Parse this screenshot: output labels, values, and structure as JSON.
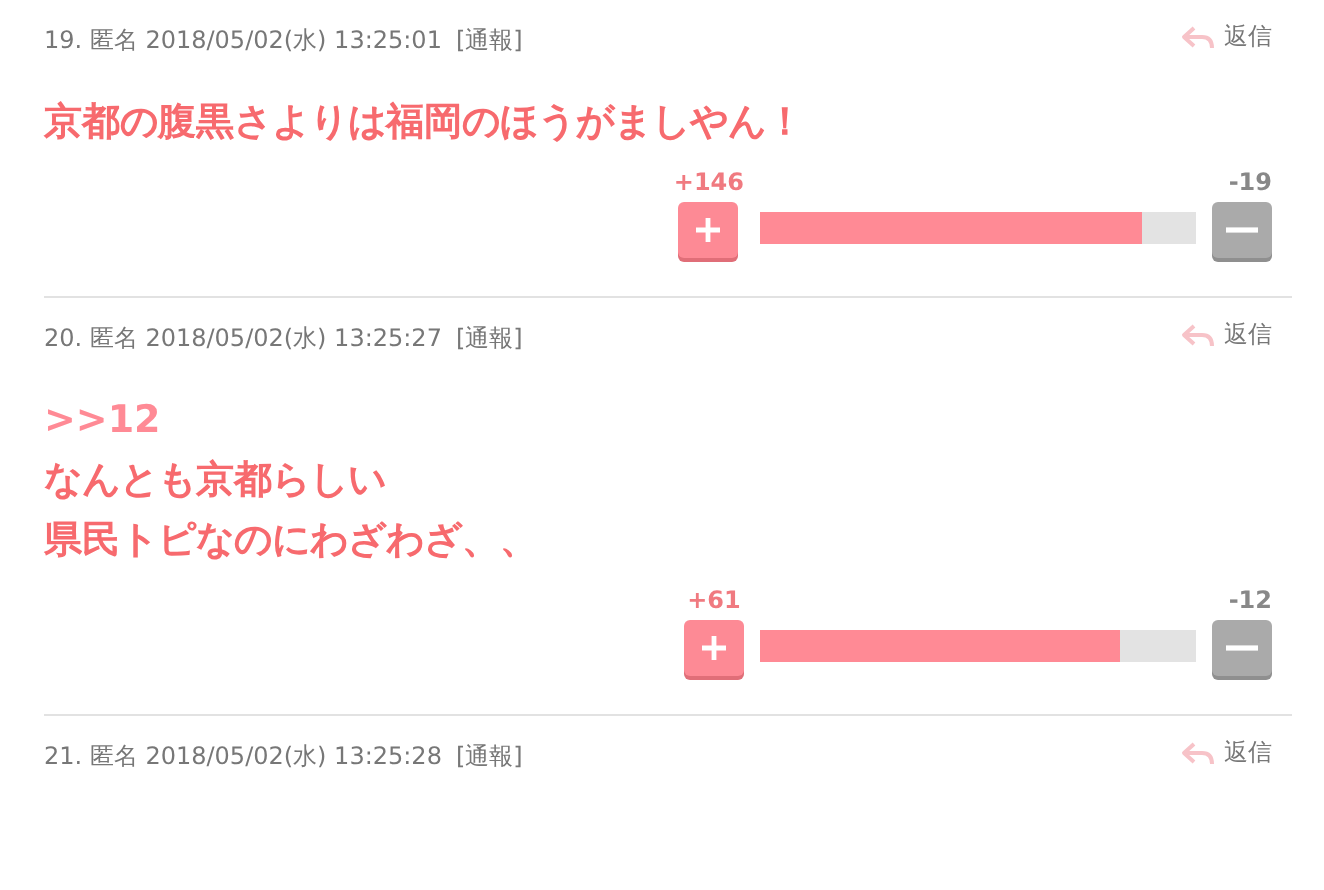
{
  "comments": [
    {
      "number": "19.",
      "author": "匿名",
      "date": "2018/05/02(水) 13:25:01",
      "report": "[通報]",
      "reply": "返信",
      "lines": [
        {
          "kind": "text",
          "text": "京都の腹黒さよりは福岡のほうがましやん！"
        }
      ],
      "vote": {
        "plus": "+146",
        "minus": "-19",
        "level": 0.876
      }
    },
    {
      "number": "20.",
      "author": "匿名",
      "date": "2018/05/02(水) 13:25:27",
      "report": "[通報]",
      "reply": "返信",
      "lines": [
        {
          "kind": "anchor",
          "text": ">>12"
        },
        {
          "kind": "text",
          "text": "なんとも京都らしい"
        },
        {
          "kind": "text",
          "text": "県民トピなのにわざわざ、、"
        }
      ],
      "vote": {
        "plus": "+61",
        "minus": "-12",
        "level": 0.826
      }
    },
    {
      "number": "21.",
      "author": "匿名",
      "date": "2018/05/02(水) 13:25:28",
      "report": "[通報]",
      "reply": "返信"
    }
  ]
}
